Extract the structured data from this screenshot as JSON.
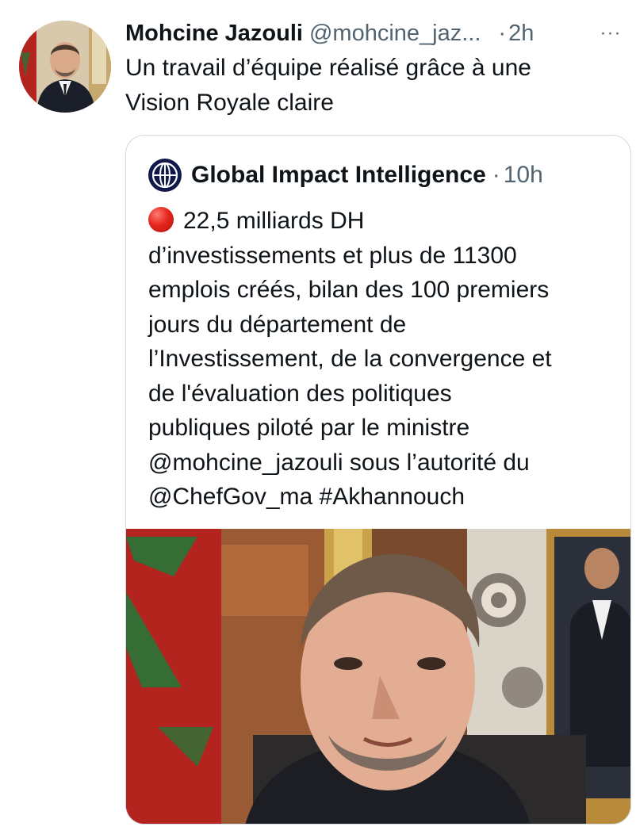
{
  "tweet": {
    "author_name": "Mohcine Jazouli",
    "author_handle": "@mohcine_jaz...",
    "separator": "·",
    "time": "2h",
    "more_label": "···",
    "text_line1": "Un travail d’équipe réalisé grâce à une",
    "text_line2": "Vision Royale claire"
  },
  "quote": {
    "author_name": "Global Impact Intelligence",
    "separator": "·",
    "time": "10h",
    "lines": [
      "22,5 milliards DH",
      "d’investissements et plus de 11300",
      "emplois créés, bilan des 100 premiers",
      "jours du département de",
      "l’Investissement, de la convergence et",
      "de l'évaluation des politiques",
      "publiques piloté par le ministre",
      "@mohcine_jazouli sous l’autorité du",
      "@ChefGov_ma #Akhannouch"
    ],
    "emoji_icon": "red-circle-icon"
  },
  "colors": {
    "text_primary": "#0f1419",
    "text_secondary": "#536471",
    "border": "#cfd9de",
    "flag_red": "#b3241f",
    "flag_green": "#1f7a3a"
  }
}
